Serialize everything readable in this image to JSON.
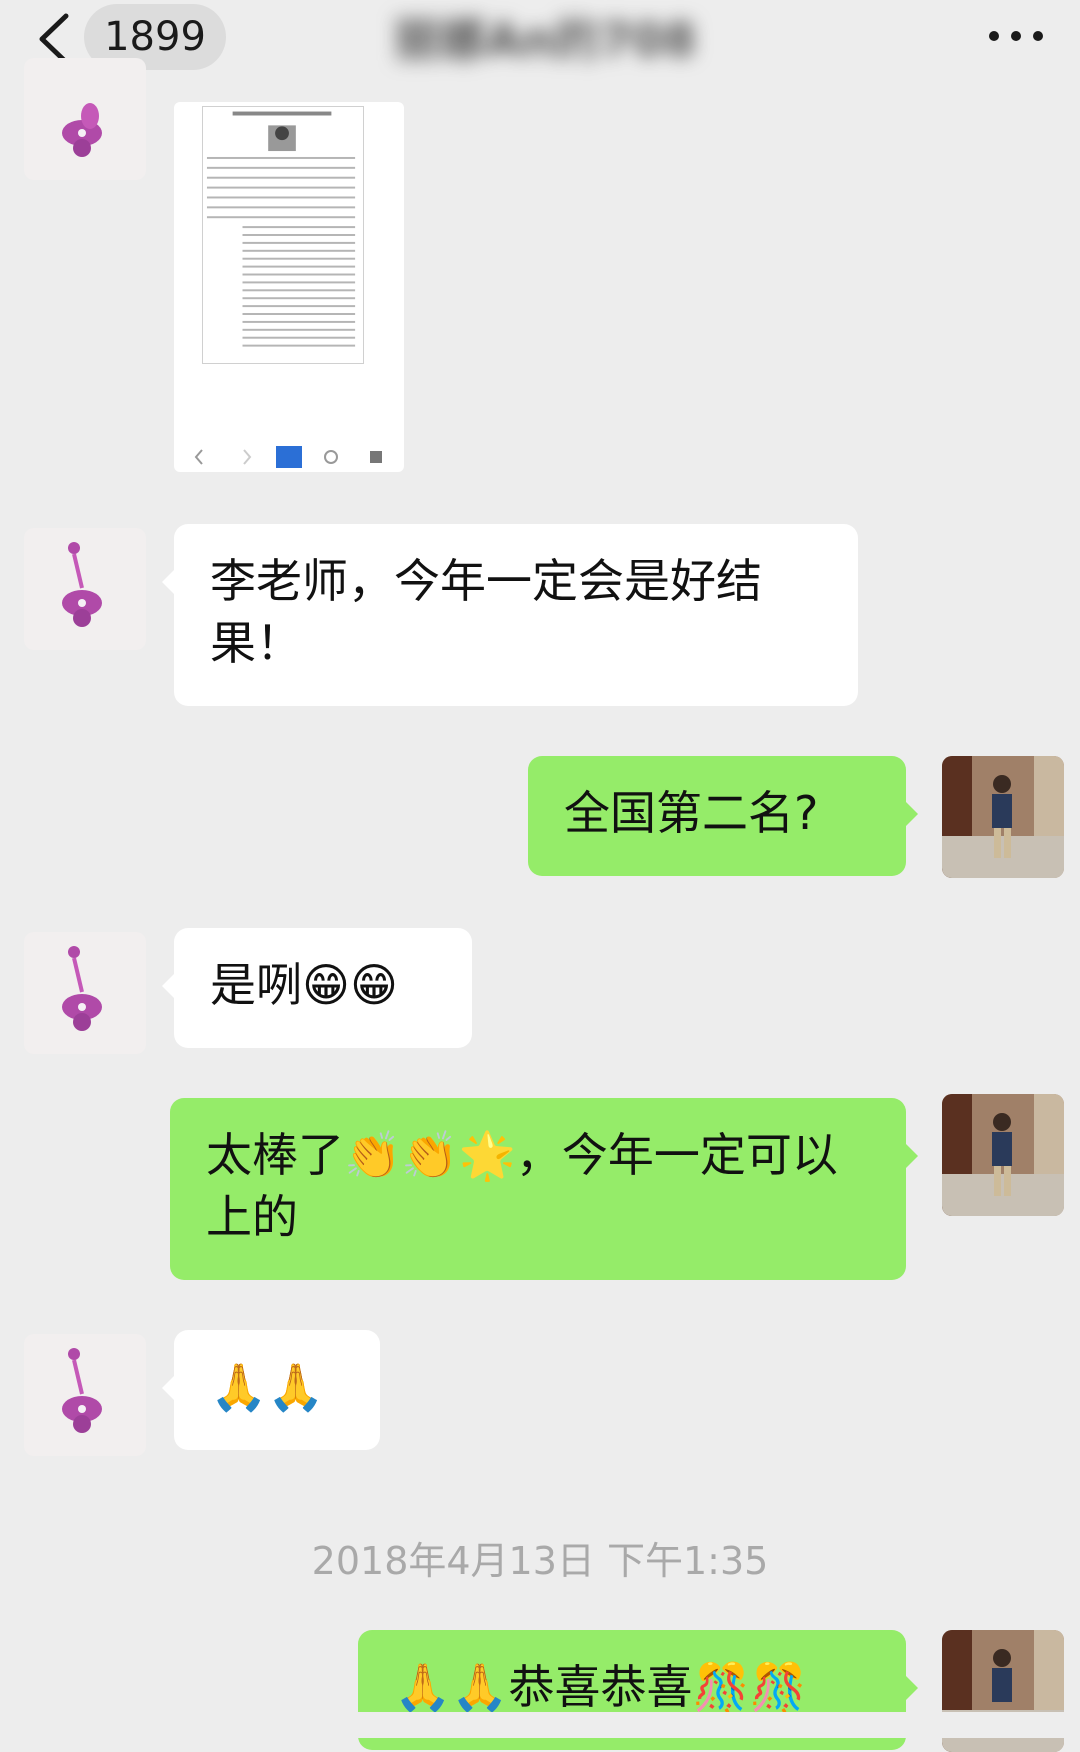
{
  "header": {
    "unread_count": "1899",
    "title_blurred": "丽娜An的708"
  },
  "messages": {
    "m1": "李老师，今年一定会是好结果！",
    "m2": "全国第二名?",
    "m3": "是咧😁😁",
    "m4": "太棒了👏👏🌟，今年一定可以上的",
    "m5": "🙏🙏",
    "m6": "🙏🙏恭喜恭喜🎊🎊"
  },
  "timestamp": "2018年4月13日 下午1:35",
  "icons": {
    "back": "chevron-left-icon",
    "more": "more-dots-icon"
  },
  "colors": {
    "background": "#ededed",
    "sent_bubble": "#95ec69",
    "received_bubble": "#ffffff"
  }
}
